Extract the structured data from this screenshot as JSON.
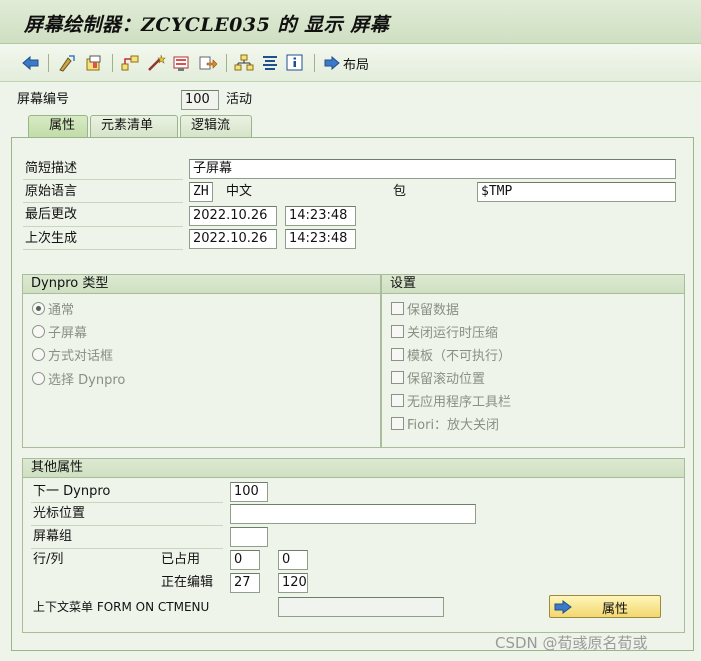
{
  "window": {
    "title": "屏幕绘制器：ZCYCLE035 的 显示 屏幕"
  },
  "toolbar": {
    "layout_label": "布局"
  },
  "header": {
    "screen_label": "屏幕编号",
    "screen_number": "100",
    "status": "活动"
  },
  "tabs": [
    {
      "label": "属性"
    },
    {
      "label": "元素清单"
    },
    {
      "label": "逻辑流"
    }
  ],
  "attributes": {
    "short_desc_label": "简短描述",
    "short_desc_value": "子屏幕",
    "orig_lang_label": "原始语言",
    "orig_lang_code": "ZH",
    "orig_lang_name": "中文",
    "package_label": "包",
    "package_value": "$TMP",
    "last_changed_label": "最后更改",
    "last_changed_date": "2022.10.26",
    "last_changed_time": "14:23:48",
    "last_generated_label": "上次生成",
    "last_generated_date": "2022.10.26",
    "last_generated_time": "14:23:48"
  },
  "dynpro_type": {
    "title": "Dynpro 类型",
    "options": [
      {
        "label": "通常",
        "selected": true
      },
      {
        "label": "子屏幕",
        "selected": false
      },
      {
        "label": "方式对话框",
        "selected": false
      },
      {
        "label": "选择 Dynpro",
        "selected": false
      }
    ]
  },
  "settings": {
    "title": "设置",
    "options": [
      {
        "label": "保留数据"
      },
      {
        "label": "关闭运行时压缩"
      },
      {
        "label": "模板（不可执行）"
      },
      {
        "label": "保留滚动位置"
      },
      {
        "label": "无应用程序工具栏"
      },
      {
        "label": "Fiori：放大关闭"
      }
    ]
  },
  "other": {
    "title": "其他属性",
    "next_label": "下一 Dynpro",
    "next_value": "100",
    "cursor_label": "光标位置",
    "cursor_value": "",
    "screen_group_label": "屏幕组",
    "screen_group_value": "",
    "row_col_label": "行/列",
    "occupied_label": "已占用",
    "occupied_row": "0",
    "occupied_col": "0",
    "editing_label": "正在编辑",
    "editing_row": "27",
    "editing_col": "120",
    "context_menu_label": "上下文菜单 FORM ON CTMENU",
    "context_menu_value": "",
    "attr_button_label": "属性"
  },
  "watermark": "CSDN @荀彧原名荀或"
}
